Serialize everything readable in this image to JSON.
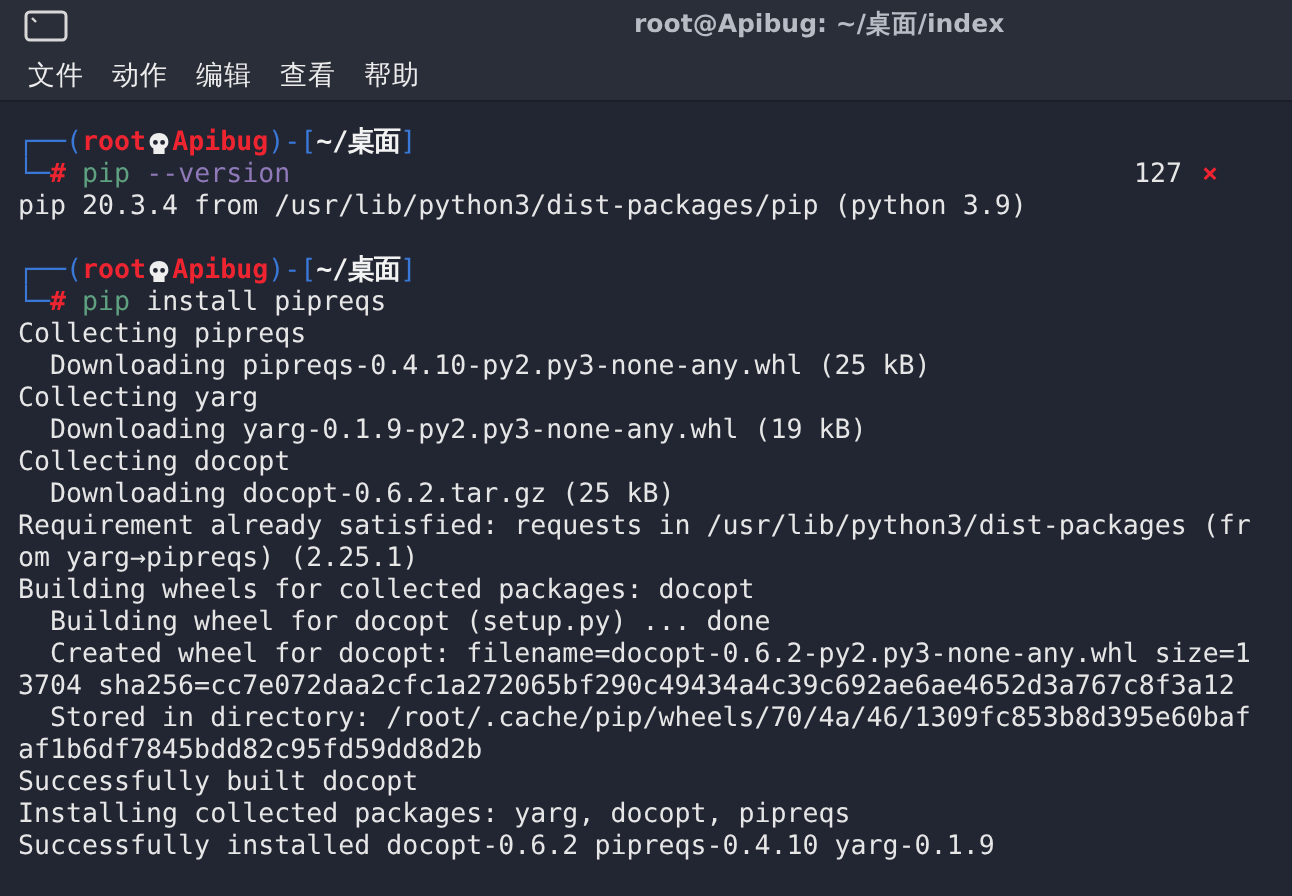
{
  "window": {
    "title": "root@Apibug: ~/桌面/index"
  },
  "menu": [
    {
      "label": "文件"
    },
    {
      "label": "动作"
    },
    {
      "label": "编辑"
    },
    {
      "label": "查看"
    },
    {
      "label": "帮助"
    }
  ],
  "blocks": [
    {
      "prompt": {
        "open": "┌──(",
        "user": "root",
        "host": "Apibug",
        "mid": ")-[",
        "path": "~/桌面",
        "close": "]",
        "corner": "└─",
        "symbol": "#"
      },
      "command": [
        {
          "text": "pip",
          "kind": "program"
        },
        {
          "text": "--version",
          "kind": "option"
        }
      ],
      "exit_code": "127",
      "error_mark": "×",
      "output": [
        "pip 20.3.4 from /usr/lib/python3/dist-packages/pip (python 3.9)"
      ]
    },
    {
      "prompt": {
        "open": "┌──(",
        "user": "root",
        "host": "Apibug",
        "mid": ")-[",
        "path": "~/桌面",
        "close": "]",
        "corner": "└─",
        "symbol": "#"
      },
      "command": [
        {
          "text": "pip",
          "kind": "program"
        },
        {
          "text": "install",
          "kind": "arg"
        },
        {
          "text": "pipreqs",
          "kind": "arg"
        }
      ],
      "output": [
        "Collecting pipreqs",
        "  Downloading pipreqs-0.4.10-py2.py3-none-any.whl (25 kB)",
        "Collecting yarg",
        "  Downloading yarg-0.1.9-py2.py3-none-any.whl (19 kB)",
        "Collecting docopt",
        "  Downloading docopt-0.6.2.tar.gz (25 kB)",
        "Requirement already satisfied: requests in /usr/lib/python3/dist-packages (fr",
        "om yarg→pipreqs) (2.25.1)",
        "Building wheels for collected packages: docopt",
        "  Building wheel for docopt (setup.py) ... done",
        "  Created wheel for docopt: filename=docopt-0.6.2-py2.py3-none-any.whl size=1",
        "3704 sha256=cc7e072daa2cfc1a272065bf290c49434a4c39c692ae6ae4652d3a767c8f3a12",
        "  Stored in directory: /root/.cache/pip/wheels/70/4a/46/1309fc853b8d395e60baf",
        "af1b6df7845bdd82c95fd59dd8d2b",
        "Successfully built docopt",
        "Installing collected packages: yarg, docopt, pipreqs",
        "Successfully installed docopt-0.6.2 pipreqs-0.4.10 yarg-0.1.9"
      ]
    }
  ]
}
